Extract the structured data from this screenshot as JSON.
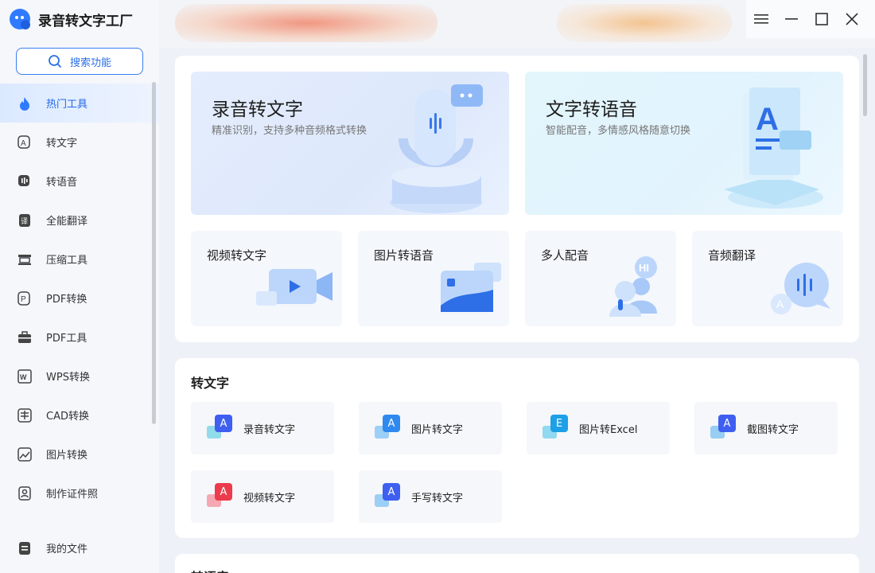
{
  "app": {
    "title": "录音转文字工厂"
  },
  "search": {
    "label": "搜索功能"
  },
  "sidebar": {
    "items": [
      {
        "label": "热门工具"
      },
      {
        "label": "转文字"
      },
      {
        "label": "转语音"
      },
      {
        "label": "全能翻译"
      },
      {
        "label": "压缩工具"
      },
      {
        "label": "PDF转换"
      },
      {
        "label": "PDF工具"
      },
      {
        "label": "WPS转换"
      },
      {
        "label": "CAD转换"
      },
      {
        "label": "图片转换"
      },
      {
        "label": "制作证件照"
      }
    ],
    "bottom": {
      "label": "我的文件"
    }
  },
  "hero": [
    {
      "title": "录音转文字",
      "subtitle": "精准识别，支持多种音频格式转换"
    },
    {
      "title": "文字转语音",
      "subtitle": "智能配音，多情感风格随意切换"
    }
  ],
  "quick": [
    {
      "title": "视频转文字"
    },
    {
      "title": "图片转语音"
    },
    {
      "title": "多人配音"
    },
    {
      "title": "音频翻译"
    }
  ],
  "section": {
    "title": "转文字",
    "tools": [
      {
        "label": "录音转文字",
        "badge": "A"
      },
      {
        "label": "图片转文字",
        "badge": "A"
      },
      {
        "label": "图片转Excel",
        "badge": "E"
      },
      {
        "label": "截图转文字",
        "badge": "A"
      },
      {
        "label": "视频转文字",
        "badge": "A"
      },
      {
        "label": "手写转文字",
        "badge": "A"
      }
    ]
  },
  "next_section": {
    "title": "转语音"
  },
  "colors": {
    "accent": "#2b6fe6",
    "active_bg": "#dbe9ff"
  }
}
